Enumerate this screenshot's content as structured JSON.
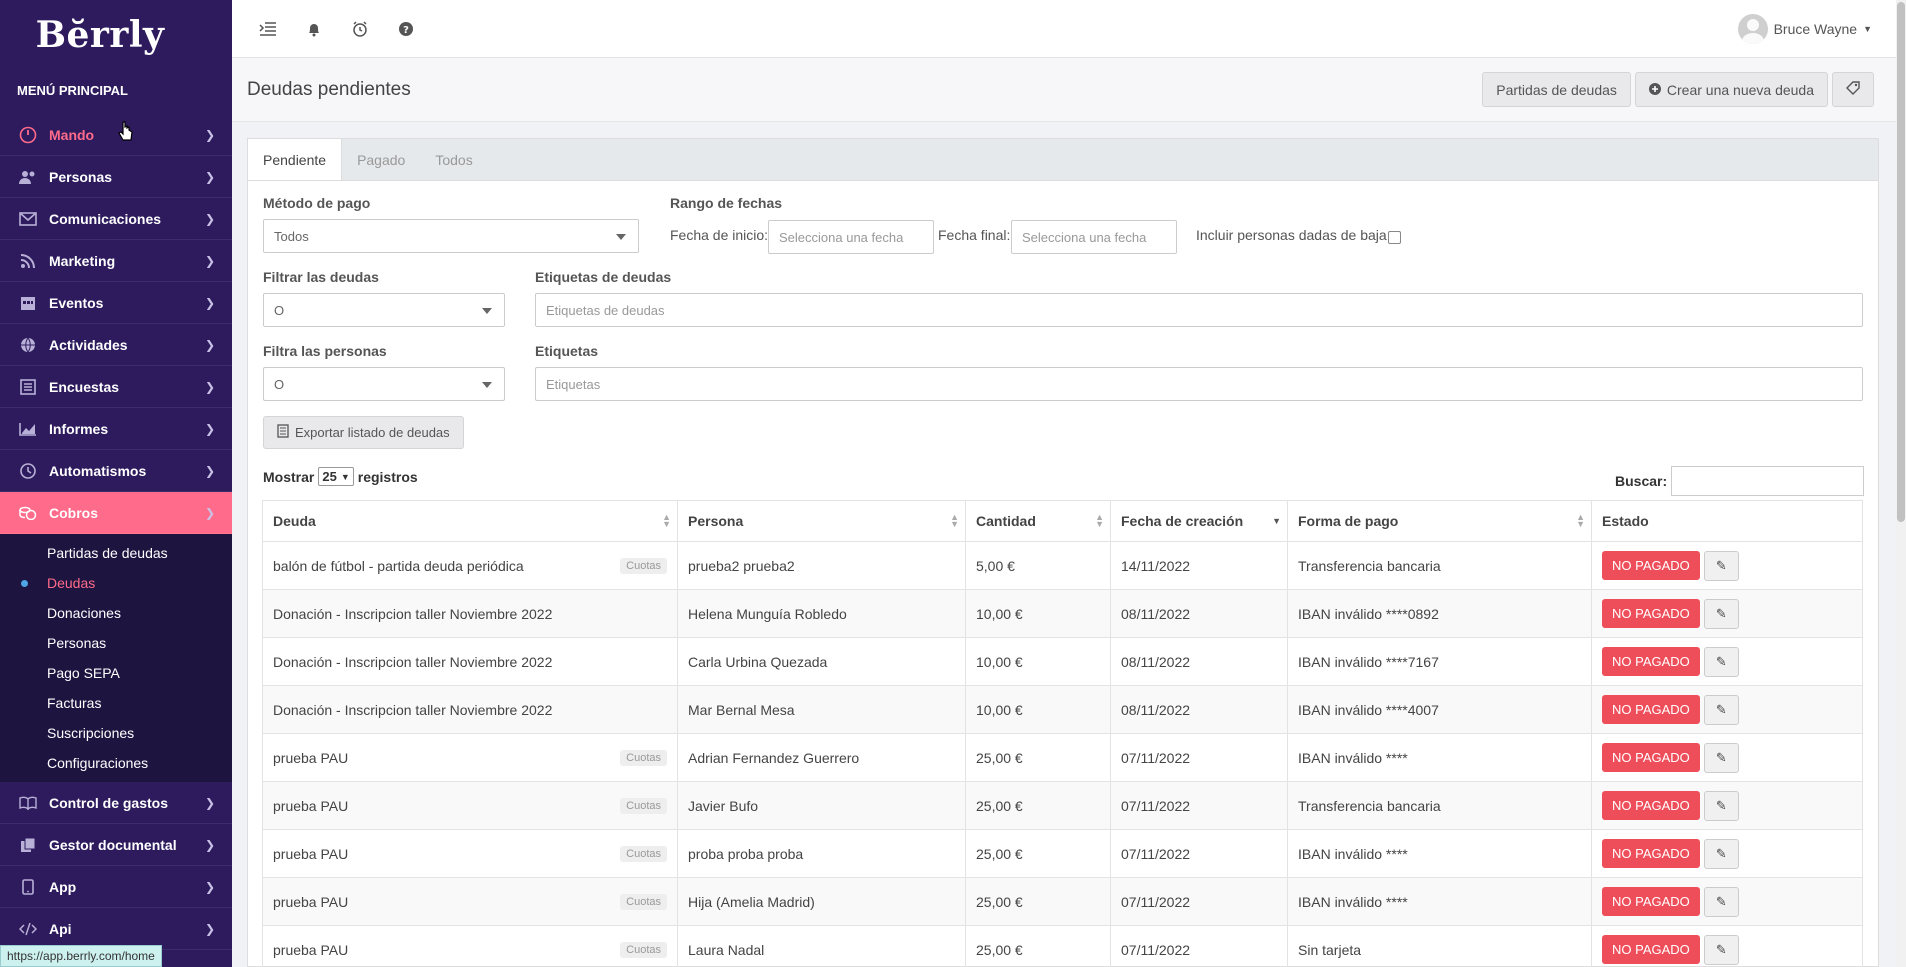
{
  "app": {
    "logo": "Bĕrrly"
  },
  "sidebar": {
    "heading": "MENÚ PRINCIPAL",
    "items": [
      {
        "label": "Mando",
        "icon": "dashboard-icon"
      },
      {
        "label": "Personas",
        "icon": "users-icon"
      },
      {
        "label": "Comunicaciones",
        "icon": "envelope-icon"
      },
      {
        "label": "Marketing",
        "icon": "rss-icon"
      },
      {
        "label": "Eventos",
        "icon": "calendar-icon"
      },
      {
        "label": "Actividades",
        "icon": "globe-icon"
      },
      {
        "label": "Encuestas",
        "icon": "list-icon"
      },
      {
        "label": "Informes",
        "icon": "chart-icon"
      },
      {
        "label": "Automatismos",
        "icon": "clock-icon"
      },
      {
        "label": "Cobros",
        "icon": "coins-icon"
      },
      {
        "label": "Control de gastos",
        "icon": "book-icon"
      },
      {
        "label": "Gestor documental",
        "icon": "documents-icon"
      },
      {
        "label": "App",
        "icon": "mobile-icon"
      },
      {
        "label": "Api",
        "icon": "code-icon"
      }
    ],
    "cobros_sub": [
      "Partidas de deudas",
      "Deudas",
      "Donaciones",
      "Personas",
      "Pago SEPA",
      "Facturas",
      "Suscripciones",
      "Configuraciones"
    ],
    "status_url": "https://app.berrly.com/home"
  },
  "topbar": {
    "user": "Bruce Wayne"
  },
  "page": {
    "title": "Deudas pendientes",
    "btn_partidas": "Partidas de deudas",
    "btn_crear": "Crear una nueva deuda"
  },
  "tabs": [
    "Pendiente",
    "Pagado",
    "Todos"
  ],
  "filters": {
    "metodo_label": "Método de pago",
    "metodo_value": "Todos",
    "rango_label": "Rango de fechas",
    "inicio_label": "Fecha de inicio:",
    "inicio_placeholder": "Selecciona una fecha",
    "final_label": "Fecha final:",
    "final_placeholder": "Selecciona una fecha",
    "baja_label": "Incluir personas dadas de baja",
    "filtrar_deudas_label": "Filtrar las deudas",
    "filtrar_deudas_value": "O",
    "etiquetas_deudas_label": "Etiquetas de deudas",
    "etiquetas_deudas_placeholder": "Etiquetas de deudas",
    "filtra_personas_label": "Filtra las personas",
    "filtra_personas_value": "O",
    "etiquetas_label": "Etiquetas",
    "etiquetas_placeholder": "Etiquetas",
    "export_label": "Exportar listado de deudas"
  },
  "list_controls": {
    "mostrar": "Mostrar",
    "page_size": "25",
    "registros": "registros",
    "buscar": "Buscar:"
  },
  "table": {
    "headers": [
      "Deuda",
      "Persona",
      "Cantidad",
      "Fecha de creación",
      "Forma de pago",
      "Estado"
    ],
    "rows": [
      {
        "deuda": "balón de fútbol - partida deuda periódica",
        "tag": "Cuotas",
        "persona": "prueba2 prueba2",
        "cantidad": "5,00 €",
        "fecha": "14/11/2022",
        "forma": "Transferencia bancaria",
        "forma_error": false,
        "estado": "NO PAGADO"
      },
      {
        "deuda": "Donación - Inscripcion taller Noviembre 2022",
        "tag": "",
        "persona": "Helena Munguía Robledo",
        "cantidad": "10,00 €",
        "fecha": "08/11/2022",
        "forma": "IBAN inválido ****0892",
        "forma_error": true,
        "estado": "NO PAGADO"
      },
      {
        "deuda": "Donación - Inscripcion taller Noviembre 2022",
        "tag": "",
        "persona": "Carla Urbina Quezada",
        "cantidad": "10,00 €",
        "fecha": "08/11/2022",
        "forma": "IBAN inválido ****7167",
        "forma_error": true,
        "estado": "NO PAGADO"
      },
      {
        "deuda": "Donación - Inscripcion taller Noviembre 2022",
        "tag": "",
        "persona": "Mar Bernal Mesa",
        "cantidad": "10,00 €",
        "fecha": "08/11/2022",
        "forma": "IBAN inválido ****4007",
        "forma_error": true,
        "estado": "NO PAGADO"
      },
      {
        "deuda": "prueba PAU",
        "tag": "Cuotas",
        "persona": "Adrian Fernandez Guerrero",
        "cantidad": "25,00 €",
        "fecha": "07/11/2022",
        "forma": "IBAN inválido ****",
        "forma_error": true,
        "estado": "NO PAGADO"
      },
      {
        "deuda": "prueba PAU",
        "tag": "Cuotas",
        "persona": "Javier Bufo",
        "cantidad": "25,00 €",
        "fecha": "07/11/2022",
        "forma": "Transferencia bancaria",
        "forma_error": false,
        "estado": "NO PAGADO"
      },
      {
        "deuda": "prueba PAU",
        "tag": "Cuotas",
        "persona": "proba proba proba",
        "cantidad": "25,00 €",
        "fecha": "07/11/2022",
        "forma": "IBAN inválido ****",
        "forma_error": true,
        "estado": "NO PAGADO"
      },
      {
        "deuda": "prueba PAU",
        "tag": "Cuotas",
        "persona": "Hija (Amelia Madrid)",
        "cantidad": "25,00 €",
        "fecha": "07/11/2022",
        "forma": "IBAN inválido ****",
        "forma_error": true,
        "estado": "NO PAGADO"
      },
      {
        "deuda": "prueba PAU",
        "tag": "Cuotas",
        "persona": "Laura Nadal",
        "cantidad": "25,00 €",
        "fecha": "07/11/2022",
        "forma": "Sin tarjeta",
        "forma_error": true,
        "estado": "NO PAGADO"
      }
    ]
  },
  "colors": {
    "sidebar": "#2d1b5e",
    "accent": "#ff6b8a",
    "danger": "#ee4d5a"
  }
}
